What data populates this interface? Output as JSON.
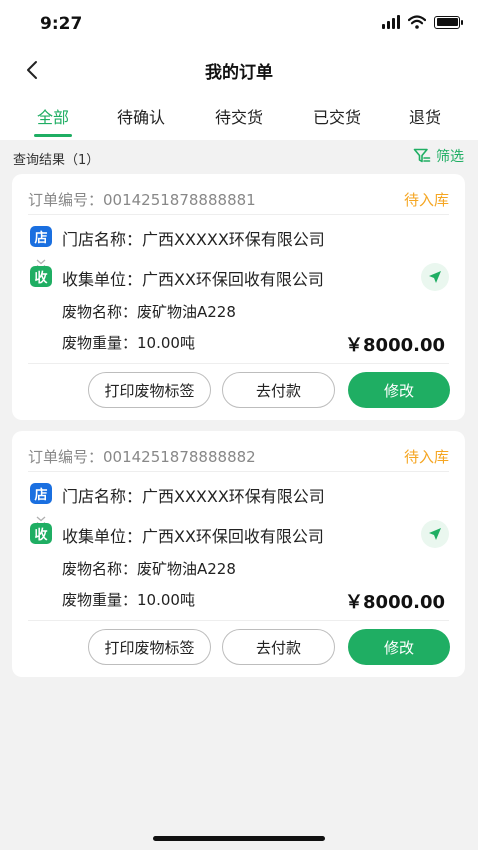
{
  "status_bar": {
    "time": "9:27"
  },
  "header": {
    "title": "我的订单"
  },
  "tabs": [
    {
      "label": "全部",
      "active": true
    },
    {
      "label": "待确认",
      "active": false
    },
    {
      "label": "待交货",
      "active": false
    },
    {
      "label": "已交货",
      "active": false
    },
    {
      "label": "退货",
      "active": false
    }
  ],
  "results": {
    "label": "查询结果（1）",
    "filter_label": "筛选"
  },
  "badges": {
    "store": "店",
    "collect": "收"
  },
  "buttons": {
    "print": "打印废物标签",
    "pay": "去付款",
    "edit": "修改"
  },
  "orders": [
    {
      "order_no": "订单编号：0014251878888881",
      "status": "待入库",
      "store": "门店名称：广西XXXXX环保有限公司",
      "collector": "收集单位：广西XX环保回收有限公司",
      "waste_name": "废物名称：废矿物油A228",
      "waste_weight": "废物重量：10.00吨",
      "price": "￥8000.00"
    },
    {
      "order_no": "订单编号：0014251878888882",
      "status": "待入库",
      "store": "门店名称：广西XXXXX环保有限公司",
      "collector": "收集单位：广西XX环保回收有限公司",
      "waste_name": "废物名称：废矿物油A228",
      "waste_weight": "废物重量：10.00吨",
      "price": "￥8000.00"
    }
  ],
  "colors": {
    "accent": "#1fae63",
    "pending": "#f5a623",
    "store_badge": "#1a6fe0"
  }
}
